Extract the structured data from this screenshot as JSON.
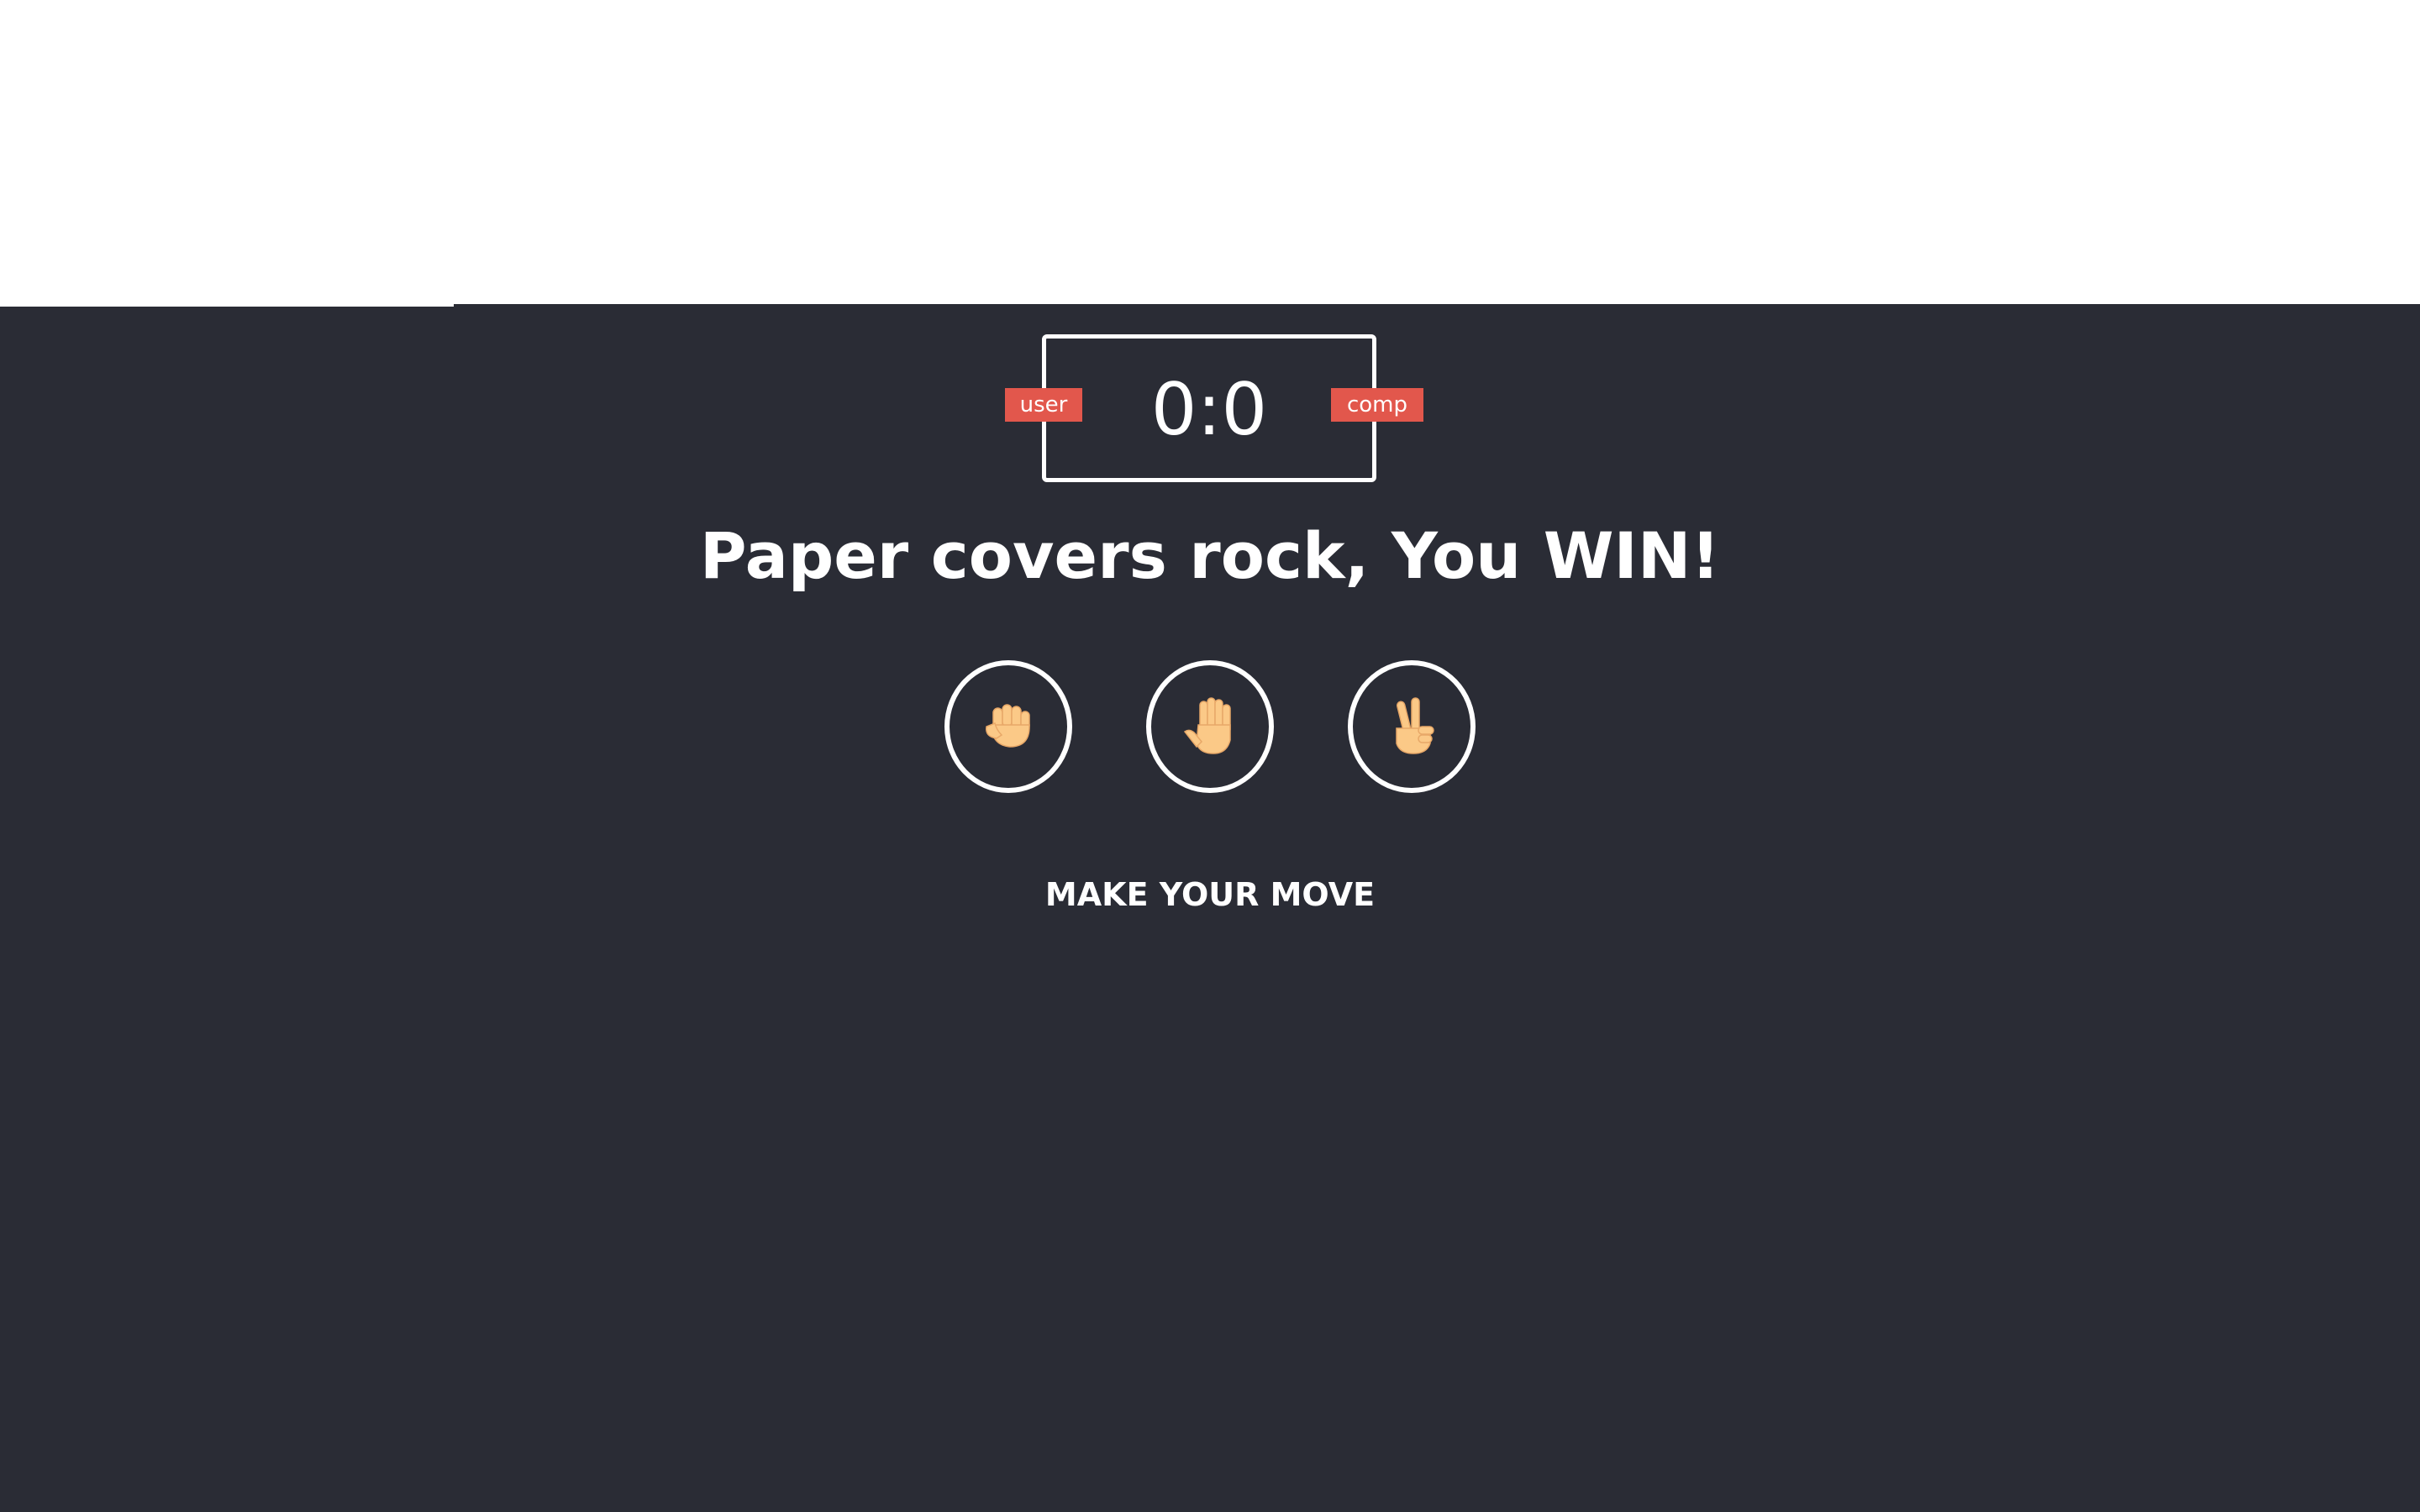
{
  "scoreboard": {
    "score": "0:0",
    "user_label": "user",
    "comp_label": "comp"
  },
  "result": {
    "message": "Paper covers rock, You WIN!"
  },
  "choices": [
    {
      "id": "rock",
      "icon": "rock-fist-icon"
    },
    {
      "id": "paper",
      "icon": "paper-hand-icon"
    },
    {
      "id": "scissors",
      "icon": "scissors-hand-icon"
    }
  ],
  "prompt": {
    "text": "MAKE YOUR MOVE"
  },
  "colors": {
    "background": "#2a2c35",
    "badge": "#e2574c",
    "foreground": "#ffffff",
    "skin": "#fbc987"
  }
}
